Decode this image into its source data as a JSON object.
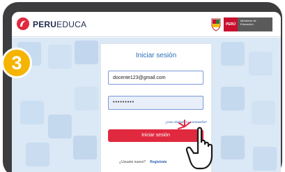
{
  "header": {
    "brand_bold": "PERU",
    "brand_rest": "EDUCA",
    "gov_peru": "PERÚ",
    "gov_ministry": "Ministerio de Educación"
  },
  "step": {
    "number": "3"
  },
  "login": {
    "title": "Iniciar sesión",
    "email_value": "docente123@gmail.com",
    "password_value": "•••••••••",
    "forgot_link": "¿Has olvidado tu contraseña?",
    "submit_label": "Iniciar sesión",
    "new_user_text": "¿Usuario nuevo?",
    "register_link": "Regístrate"
  },
  "colors": {
    "accent_blue": "#2b6fb8",
    "button_red": "#e0293f",
    "badge_yellow": "#f5b400",
    "frame": "#3d3d3f"
  },
  "icons": [
    "peruecuca-logo-icon",
    "peru-shield-icon",
    "hand-cursor-icon"
  ]
}
